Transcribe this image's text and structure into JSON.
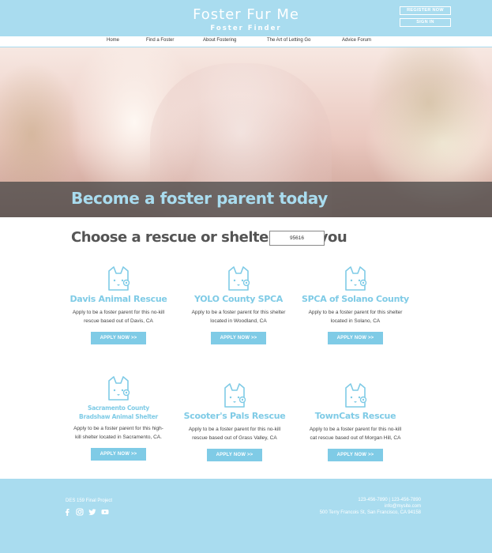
{
  "site": {
    "title": "Foster Fur Me",
    "subtitle": "Foster Finder",
    "register_label": "REGISTER NOW",
    "signin_label": "SIGN IN"
  },
  "nav": {
    "items": [
      {
        "label": "Home"
      },
      {
        "label": "Find a Foster"
      },
      {
        "label": "About Fostering"
      },
      {
        "label": "The Art of Letting Go"
      },
      {
        "label": "Advice Forum"
      }
    ]
  },
  "hero": {
    "banner_text": "Become a foster parent today"
  },
  "search": {
    "heading": "Choose a rescue or shelter near you",
    "zip_value": "95616"
  },
  "cards": [
    {
      "name": "Davis Animal Rescue",
      "desc": "Apply to be a foster parent for this no-kill rescue based out of Davis, CA",
      "button": "APPLY NOW >>"
    },
    {
      "name": "YOLO County SPCA",
      "desc": "Apply to be a foster parent for this shelter located in Woodland, CA",
      "button": "APPLY NOW >>"
    },
    {
      "name": "SPCA of Solano County",
      "desc": "Apply to be a foster parent for this shelter located in Solano, CA",
      "button": "APPLY NOW >>"
    },
    {
      "name": "Sacramento County Bradshaw Animal Shelter",
      "desc": "Apply to be a foster parent for this high-kill shelter located in Sacramento, CA.",
      "button": "APPLY NOW >>"
    },
    {
      "name": "Scooter's Pals Rescue",
      "desc": "Apply to be a foster parent for this no-kill rescue based out of Grass Valley, CA",
      "button": "APPLY NOW >>"
    },
    {
      "name": "TownCats Rescue",
      "desc": "Apply to be a foster parent for this no-kill cat rescue based out of Morgan Hill, CA",
      "button": "APPLY NOW >>"
    }
  ],
  "footer": {
    "credit": "DES 159 Final Project",
    "phones": "123-456-7890 | 123-456-7890",
    "email": "info@mysite.com",
    "address": "500 Terry Francois St, San Francisco, CA 94158",
    "social_icons": [
      "facebook-icon",
      "instagram-icon",
      "twitter-icon",
      "youtube-icon"
    ]
  },
  "colors": {
    "brand_blue": "#a9dcef",
    "accent_blue": "#7fcbe6",
    "banner_overlay": "#464646"
  }
}
